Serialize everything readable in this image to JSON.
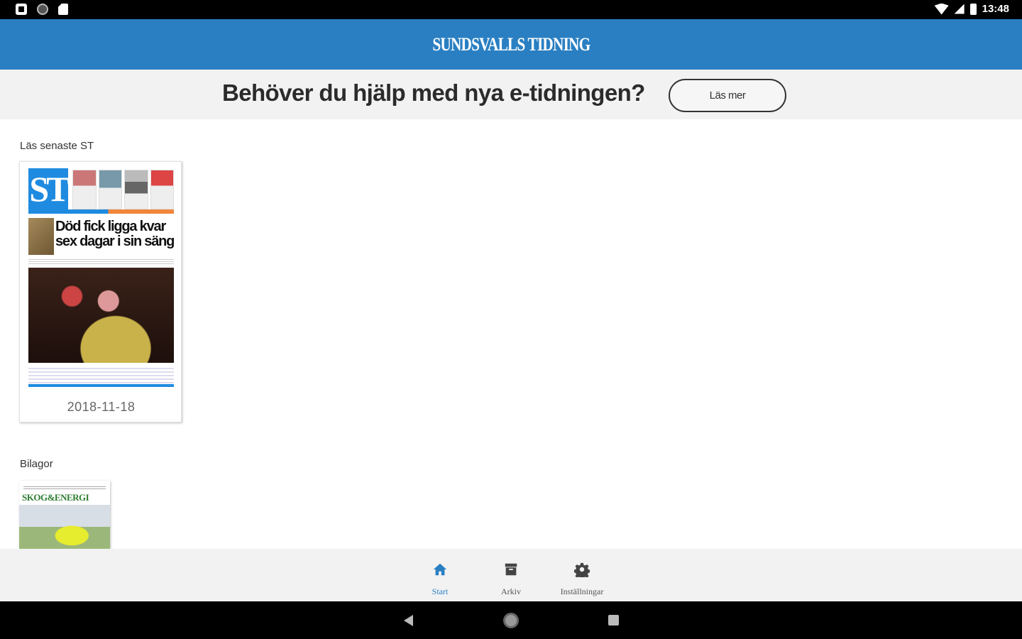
{
  "status_bar": {
    "time": "13:48"
  },
  "app_bar": {
    "logo_text": "Sundsvalls Tidning"
  },
  "help_banner": {
    "text": "Behöver du hjälp med nya e-tidningen?",
    "button_label": "Läs mer"
  },
  "latest": {
    "section_title": "Läs senaste ST",
    "issue": {
      "masthead": "ST",
      "headline": "Död fick ligga kvar sex dagar i sin säng",
      "date": "2018-11-18"
    }
  },
  "supplements": {
    "section_title": "Bilagor",
    "items": [
      {
        "title": "SKOG&ENERGI"
      }
    ]
  },
  "bottom_nav": {
    "items": [
      {
        "label": "Start",
        "icon": "home-icon",
        "active": true
      },
      {
        "label": "Arkiv",
        "icon": "archive-icon",
        "active": false
      },
      {
        "label": "Inställningar",
        "icon": "gear-icon",
        "active": false
      }
    ]
  },
  "colors": {
    "brand": "#2a7fc2",
    "banner_bg": "#f2f2f2",
    "nav_active": "#2a7fc2"
  }
}
